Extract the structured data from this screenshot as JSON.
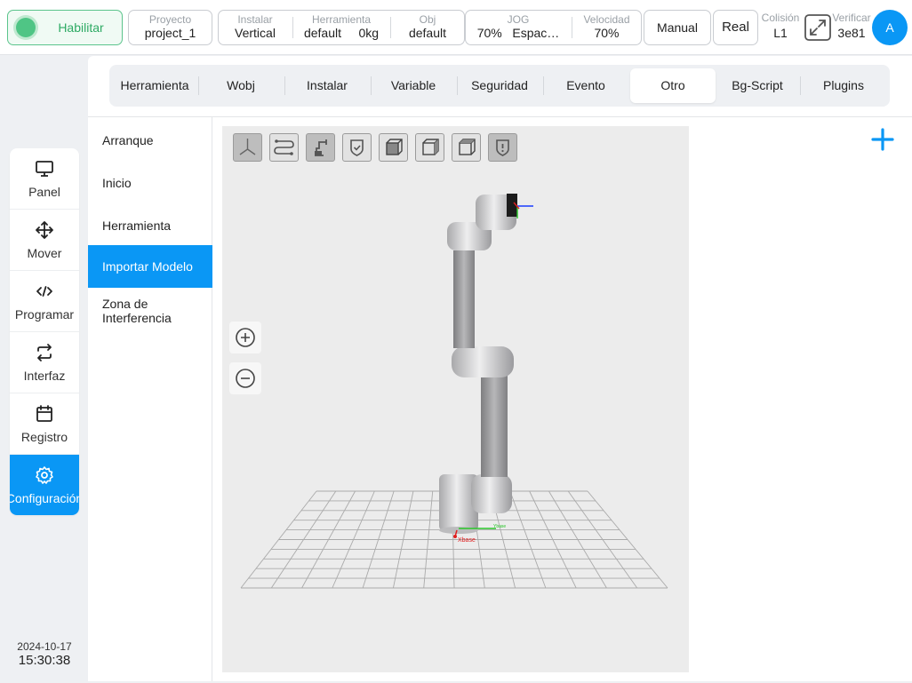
{
  "topbar": {
    "enable_label": "Habilitar",
    "project": {
      "label": "Proyecto",
      "value": "project_1"
    },
    "install": {
      "label": "Instalar",
      "value": "Vertical"
    },
    "tool": {
      "label": "Herramienta",
      "value": "default",
      "extra": "0kg"
    },
    "obj": {
      "label": "Obj",
      "value": "default"
    },
    "jog": {
      "label": "JOG",
      "value": "70%",
      "extra": "Espac…"
    },
    "speed": {
      "label": "Velocidad",
      "value": "70%"
    },
    "mode_button": "Manual",
    "real_button": "Real",
    "collision": {
      "label": "Colisión",
      "value": "L1"
    },
    "verify": {
      "label": "Verificar",
      "value": "3e81"
    },
    "avatar": "A"
  },
  "sidenav": {
    "items": [
      {
        "label": "Panel",
        "icon": "monitor-icon"
      },
      {
        "label": "Mover",
        "icon": "move-arrows-icon"
      },
      {
        "label": "Programar",
        "icon": "code-icon"
      },
      {
        "label": "Interfaz",
        "icon": "swap-icon"
      },
      {
        "label": "Registro",
        "icon": "calendar-icon"
      },
      {
        "label": "Configuración",
        "icon": "gear-icon"
      }
    ],
    "date": "2024-10-17",
    "time": "15:30:38"
  },
  "tabs": [
    "Herramienta",
    "Wobj",
    "Instalar",
    "Variable",
    "Seguridad",
    "Evento",
    "Otro",
    "Bg-Script",
    "Plugins"
  ],
  "active_tab": "Otro",
  "submenu": [
    "Arranque",
    "Inicio",
    "Herramienta",
    "Importar Modelo",
    "Zona de Interferencia"
  ],
  "active_submenu": "Importar Modelo",
  "viewport": {
    "base_label": "Xbase",
    "y_label": "Ybase"
  },
  "colors": {
    "accent": "#0a97f5",
    "enable": "#4fc585"
  }
}
